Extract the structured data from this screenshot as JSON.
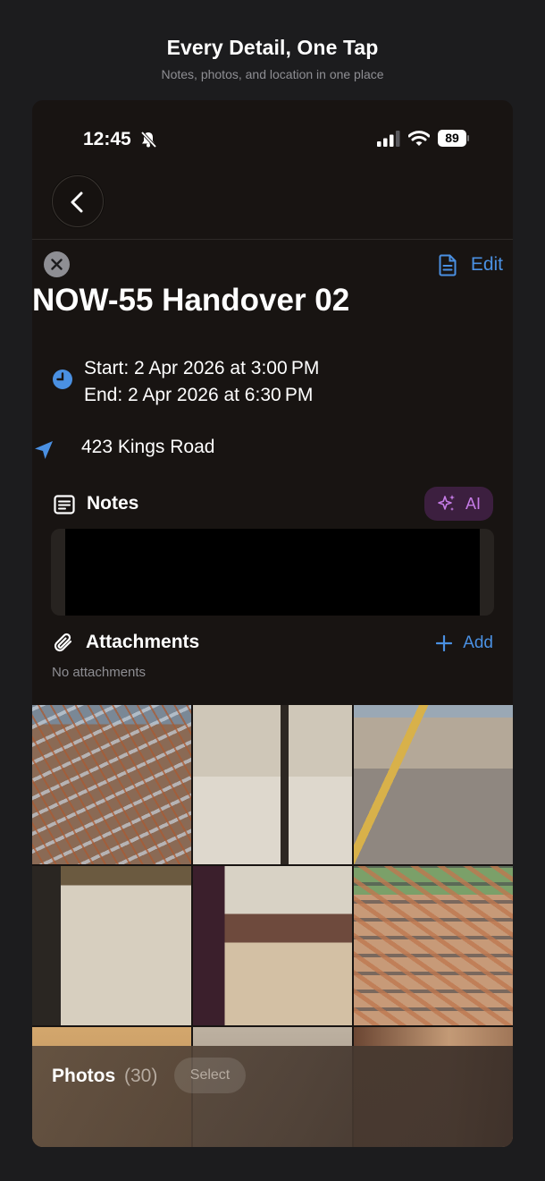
{
  "header": {
    "title": "Every Detail, One Tap",
    "subtitle": "Notes, photos, and location in one place"
  },
  "status_bar": {
    "time": "12:45",
    "battery": "89",
    "icons": [
      "bell-slash-icon",
      "cellular-signal-icon",
      "wifi-icon",
      "battery-icon"
    ]
  },
  "nav": {
    "back_icon": "chevron-left-icon",
    "close_icon": "close-icon",
    "document_icon": "document-icon",
    "edit_label": "Edit"
  },
  "event": {
    "title": "NOW-55 Handover 02",
    "start": "Start: 2 Apr 2026 at 3:00 PM",
    "end": "End: 2 Apr 2026 at 6:30 PM",
    "location": "423 Kings Road"
  },
  "notes": {
    "label": "Notes",
    "ai_label": "AI",
    "ai_icon": "sparkles-icon"
  },
  "attachments": {
    "label": "Attachments",
    "add_label": "Add",
    "empty_text": "No attachments"
  },
  "photos": {
    "label": "Photos",
    "count": "(30)",
    "select_label": "Select",
    "tiles": [
      "rebar-yard-photo",
      "empty-room-photo",
      "formwork-site-photo",
      "room-corner-photo",
      "wooden-floor-room-photo",
      "timber-stack-photo",
      "partial-photo-7",
      "partial-photo-8",
      "partial-photo-9"
    ]
  },
  "colors": {
    "accent_blue": "#4a90e2",
    "ai_purple": "#c57be6",
    "background": "#181412"
  }
}
